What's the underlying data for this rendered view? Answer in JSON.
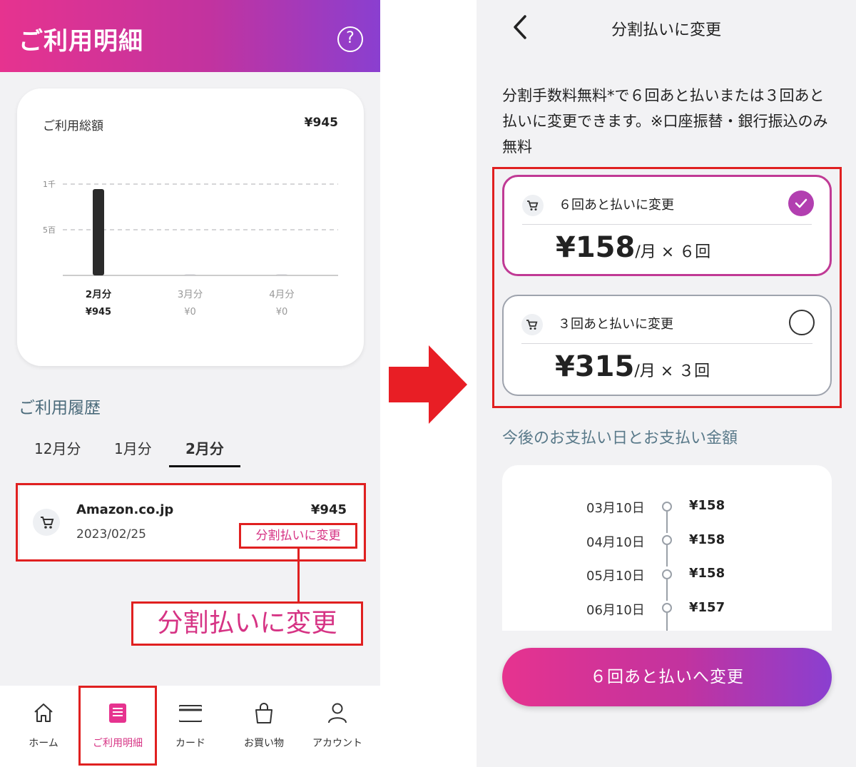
{
  "left": {
    "header_title": "ご利用明細",
    "help_icon": "?",
    "usage": {
      "label": "ご利用総額",
      "total": "¥945"
    },
    "chart_data": {
      "type": "bar",
      "categories": [
        "2月分",
        "3月分",
        "4月分"
      ],
      "values": [
        945,
        0,
        0
      ],
      "value_labels": [
        "¥945",
        "¥0",
        "¥0"
      ],
      "ytick_labels": [
        "1千",
        "5百"
      ],
      "yticks": [
        1000,
        500
      ],
      "ylim": [
        0,
        1000
      ],
      "grid": true,
      "bar_color": "#2b2b2b"
    },
    "history_title": "ご利用履歴",
    "month_tabs": [
      {
        "label": "12月分",
        "active": false
      },
      {
        "label": "1月分",
        "active": false
      },
      {
        "label": "2月分",
        "active": true
      }
    ],
    "transaction": {
      "merchant": "Amazon.co.jp",
      "date": "2023/02/25",
      "amount": "¥945",
      "installment_link": "分割払いに変更"
    },
    "callout_text": "分割払いに変更",
    "nav": [
      {
        "label": "ホーム",
        "icon": "home-icon",
        "active": false
      },
      {
        "label": "ご利用明細",
        "icon": "statement-icon",
        "active": true
      },
      {
        "label": "カード",
        "icon": "card-icon",
        "active": false
      },
      {
        "label": "お買い物",
        "icon": "shopping-bag-icon",
        "active": false
      },
      {
        "label": "アカウント",
        "icon": "account-icon",
        "active": false
      }
    ]
  },
  "right": {
    "title": "分割払いに変更",
    "description": "分割手数料無料*で６回あと払いまたは３回あと払いに変更できます。※口座振替・銀行振込のみ無料",
    "options": [
      {
        "label": "６回あと払いに変更",
        "price": "¥158",
        "unit": "/月",
        "times": " × ６回",
        "selected": true
      },
      {
        "label": "３回あと払いに変更",
        "price": "¥315",
        "unit": "/月",
        "times": " × ３回",
        "selected": false
      }
    ],
    "schedule_title": "今後のお支払い日とお支払い金額",
    "schedule": [
      {
        "date": "03月10日",
        "amount": "¥158"
      },
      {
        "date": "04月10日",
        "amount": "¥158"
      },
      {
        "date": "05月10日",
        "amount": "¥158"
      },
      {
        "date": "06月10日",
        "amount": "¥157"
      }
    ],
    "submit_label": "６回あと払いへ変更"
  },
  "colors": {
    "brand_gradient_start": "#e6338f",
    "brand_gradient_end": "#8a3fd0",
    "highlight_red": "#e02020",
    "link_pink": "#d63384"
  }
}
